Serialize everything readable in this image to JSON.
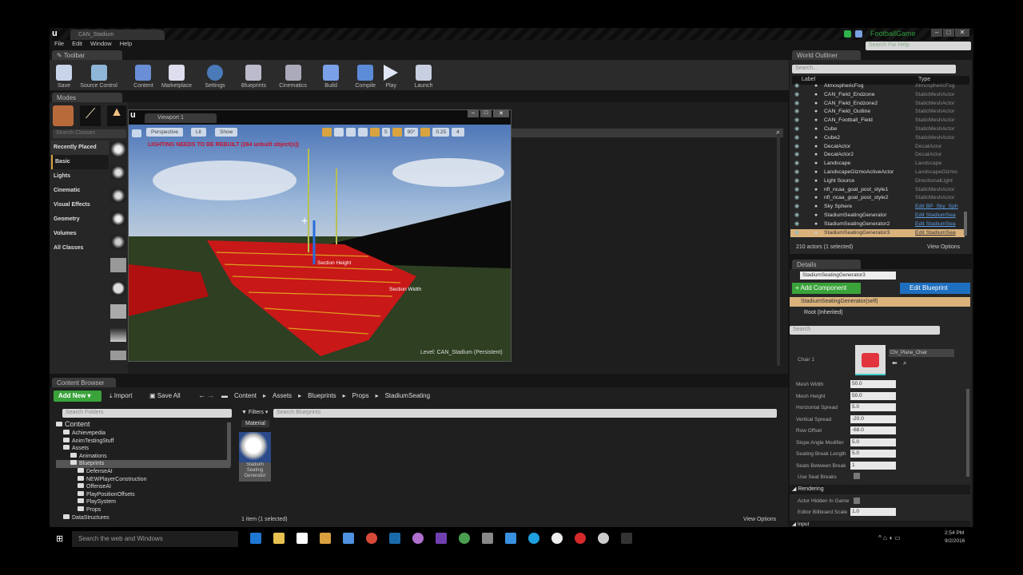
{
  "window": {
    "project_tab": "CAN_Stadium",
    "project_name": "FootballGame",
    "help_search_placeholder": "Search For Help"
  },
  "menu": [
    "File",
    "Edit",
    "Window",
    "Help"
  ],
  "toolbar": {
    "tab": "Toolbar",
    "buttons": [
      "Save",
      "Source Control",
      "Content",
      "Marketplace",
      "Settings",
      "Blueprints",
      "Cinematics",
      "Build",
      "Compile",
      "Play",
      "Launch"
    ]
  },
  "modes": {
    "tab": "Modes",
    "search_placeholder": "Search Classes",
    "categories": [
      "Recently Placed",
      "Basic",
      "Lights",
      "Cinematic",
      "Visual Effects",
      "Geometry",
      "Volumes",
      "All Classes"
    ],
    "selected": "Basic"
  },
  "viewport": {
    "tab": "Viewport 1",
    "perspective": "Perspective",
    "lit": "Lit",
    "show": "Show",
    "grid_snap": "5",
    "rot_snap": "90°",
    "scale_snap": "0.25",
    "cam_speed": "4",
    "warning": "LIGHTING NEEDS TO BE REBUILT (264 unbuilt object(s))",
    "label_height": "Section Height",
    "label_width": "Section Width",
    "level": "Level:  CAN_Stadium (Persistent)"
  },
  "outliner": {
    "tab": "World Outliner",
    "search_placeholder": "Search...",
    "col_label": "Label",
    "col_type": "Type",
    "rows": [
      {
        "label": "AtmosphericFog",
        "type": "AtmosphericFog"
      },
      {
        "label": "CAN_Field_Endzone",
        "type": "StaticMeshActor"
      },
      {
        "label": "CAN_Field_Endzone2",
        "type": "StaticMeshActor"
      },
      {
        "label": "CAN_Field_Outline",
        "type": "StaticMeshActor"
      },
      {
        "label": "CAN_Football_Field",
        "type": "StaticMeshActor"
      },
      {
        "label": "Cube",
        "type": "StaticMeshActor"
      },
      {
        "label": "Cube2",
        "type": "StaticMeshActor"
      },
      {
        "label": "DecalActor",
        "type": "DecalActor"
      },
      {
        "label": "DecalActor2",
        "type": "DecalActor"
      },
      {
        "label": "Landscape",
        "type": "Landscape"
      },
      {
        "label": "LandscapeGizmoActiveActor",
        "type": "LandscapeGizmo"
      },
      {
        "label": "Light Source",
        "type": "DirectionalLight"
      },
      {
        "label": "nfl_ncaa_goal_post_style1",
        "type": "StaticMeshActor"
      },
      {
        "label": "nfl_ncaa_goal_post_style2",
        "type": "StaticMeshActor"
      },
      {
        "label": "Sky Sphere",
        "type": "Edit BP_Sky_Sph"
      },
      {
        "label": "StadiumSeatingGenerator",
        "type": "Edit StadiumSea"
      },
      {
        "label": "StadiumSeatingGenerator2",
        "type": "Edit StadiumSea"
      },
      {
        "label": "StadiumSeatingGenerator3",
        "type": "Edit StadiumSea"
      }
    ],
    "selected_index": 17,
    "status": "210 actors (1 selected)",
    "view_options": "View Options"
  },
  "details": {
    "tab": "Details",
    "name": "StadiumSeatingGenerator3",
    "add_component": "+ Add Component",
    "edit_blueprint": "Edit Blueprint",
    "self": "StadiumSeatingGenerator(self)",
    "root": "Root (Inherited)",
    "search_placeholder": "Search",
    "chair_label": "Chair 1",
    "chair_asset": "Chr_Plane_Chair",
    "props": [
      {
        "label": "Mesh Width",
        "value": "50.0"
      },
      {
        "label": "Mesh Height",
        "value": "50.0"
      },
      {
        "label": "Horizontal Spread",
        "value": "5.0"
      },
      {
        "label": "Vertical Spread",
        "value": "-20.0"
      },
      {
        "label": "Row Offset",
        "value": "-68.0"
      },
      {
        "label": "Slope Angle Modifier",
        "value": "5.0"
      },
      {
        "label": "Seating Break Length",
        "value": "5.0"
      },
      {
        "label": "Seats Between Break",
        "value": "1"
      }
    ],
    "use_seat_breaks": "Use Seat Breaks",
    "rendering": "Rendering",
    "hidden_in_game": "Actor Hidden In Game",
    "billboard_label": "Editor Billboard Scale",
    "billboard_value": "1.0",
    "input": "Input"
  },
  "content_browser": {
    "tab": "Content Browser",
    "add_new": "Add New",
    "import": "Import",
    "save_all": "Save All",
    "breadcrumb": [
      "Content",
      "Assets",
      "Blueprints",
      "Props",
      "StadiumSeating"
    ],
    "folder_search": "Search Folders",
    "asset_search": "Search Blueprints",
    "filters": "Filters",
    "filter_chip": "Material",
    "tree": [
      {
        "label": "Content",
        "depth": 0
      },
      {
        "label": "Achievepedia",
        "depth": 1
      },
      {
        "label": "AnimTestingStuff",
        "depth": 1
      },
      {
        "label": "Assets",
        "depth": 1
      },
      {
        "label": "Animations",
        "depth": 2
      },
      {
        "label": "Blueprints",
        "depth": 2
      },
      {
        "label": "DefenseAI",
        "depth": 3
      },
      {
        "label": "NEWPlayerConstruction",
        "depth": 3
      },
      {
        "label": "OffenseAI",
        "depth": 3
      },
      {
        "label": "PlayPositionOffsets",
        "depth": 3
      },
      {
        "label": "PlaySystem",
        "depth": 3
      },
      {
        "label": "Props",
        "depth": 3
      },
      {
        "label": "DataStructures",
        "depth": 1
      }
    ],
    "selected_folder": "Blueprints",
    "asset_name": "Stadium Seating Generator",
    "status": "1 item (1 selected)",
    "view_options": "View Options"
  },
  "taskbar": {
    "search": "Search the web and Windows",
    "time": "2:54 PM",
    "date": "9/2/2016"
  },
  "colors": {
    "accent_green": "#3aa33a",
    "accent_blue": "#1f6fc0",
    "selection": "#d9b27c",
    "warning_red": "#c8102e"
  }
}
